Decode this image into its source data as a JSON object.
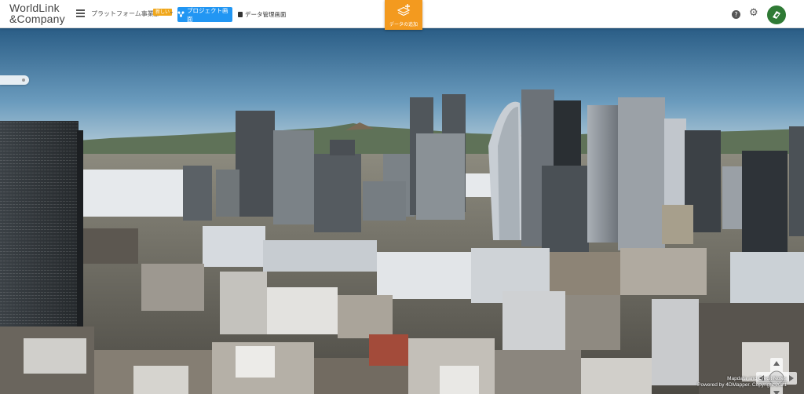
{
  "header": {
    "logo_line1": "WorldLink",
    "logo_line2": "&Company",
    "org_name": "プラットフォーム事業部",
    "org_badge": "新しい",
    "org_chevron": "⌄",
    "project_button": "プロジェクト画面",
    "data_button": "データ管理画面",
    "add_data_button": "データの追加",
    "help_label": "?"
  },
  "viewer": {
    "credit_line1_prefix": "Mapdata and ",
    "credit_link": "Credit Notes",
    "credit_line2": "Powered by 4DMapper. Copyright 2021"
  },
  "colors": {
    "brand_orange": "#f39a1f",
    "primary_blue": "#2196f3",
    "new_badge": "#f0a71b",
    "avatar_green": "#2f7a35"
  },
  "icons": [
    "menu-icon",
    "chevron-down-icon",
    "project-icon",
    "data-icon",
    "add-layers-icon",
    "help-icon",
    "gear-icon",
    "user-logo-icon",
    "navigation-control-icon"
  ]
}
